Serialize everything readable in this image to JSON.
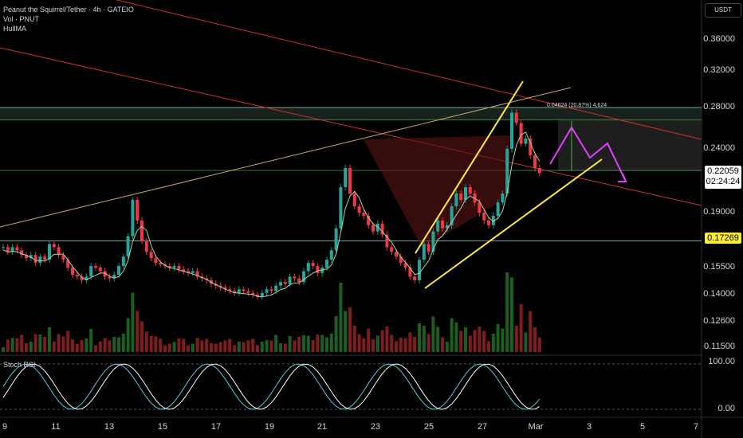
{
  "header": {
    "symbol_line": "Peanut the Squirrel/Tether · 4h · GATEIO",
    "volume_line": "Vol · PNUT",
    "indicator_line": "HullMA",
    "currency": "USDT"
  },
  "rsi": {
    "label": "Stoch RSI",
    "ticks": [
      "100.00",
      "0.00"
    ]
  },
  "annotation": "0.04624 (20.87%) 4,624",
  "price_badges": {
    "last": "0.22059",
    "countdown": "02:24:24",
    "level": "0.17269"
  },
  "colors": {
    "up": "#089981",
    "down": "#f23645",
    "bg": "#000000",
    "trend": "#ffeb3b",
    "projection": "#e040fb"
  },
  "chart_data": {
    "type": "candlestick",
    "y_ticks": [
      0.36,
      0.32,
      0.28,
      0.24,
      0.19,
      0.155,
      0.14,
      0.126,
      0.115
    ],
    "y_tick_labels": [
      "0.36000",
      "0.32000",
      "0.28000",
      "0.24000",
      "0.19000",
      "0.15500",
      "0.14000",
      "0.12600",
      "0.11500"
    ],
    "x_tick_labels": [
      "9",
      "11",
      "13",
      "15",
      "17",
      "19",
      "21",
      "23",
      "25",
      "27",
      "Mar",
      "3",
      "5",
      "7"
    ],
    "horizontal_levels": [
      0.28,
      0.268,
      0.172
    ],
    "closes": [
      0.168,
      0.165,
      0.168,
      0.166,
      0.163,
      0.161,
      0.163,
      0.158,
      0.162,
      0.16,
      0.17,
      0.168,
      0.163,
      0.16,
      0.155,
      0.151,
      0.15,
      0.148,
      0.15,
      0.156,
      0.155,
      0.153,
      0.15,
      0.149,
      0.151,
      0.156,
      0.162,
      0.175,
      0.2,
      0.185,
      0.172,
      0.165,
      0.161,
      0.158,
      0.157,
      0.156,
      0.155,
      0.156,
      0.154,
      0.153,
      0.152,
      0.153,
      0.15,
      0.149,
      0.148,
      0.146,
      0.145,
      0.144,
      0.143,
      0.142,
      0.141,
      0.143,
      0.142,
      0.141,
      0.14,
      0.139,
      0.141,
      0.143,
      0.142,
      0.145,
      0.147,
      0.146,
      0.15,
      0.149,
      0.147,
      0.153,
      0.158,
      0.156,
      0.152,
      0.155,
      0.16,
      0.166,
      0.18,
      0.21,
      0.225,
      0.205,
      0.195,
      0.19,
      0.188,
      0.182,
      0.178,
      0.183,
      0.176,
      0.168,
      0.165,
      0.162,
      0.158,
      0.155,
      0.15,
      0.148,
      0.16,
      0.17,
      0.165,
      0.178,
      0.185,
      0.18,
      0.182,
      0.195,
      0.205,
      0.2,
      0.21,
      0.205,
      0.198,
      0.19,
      0.185,
      0.182,
      0.188,
      0.198,
      0.205,
      0.24,
      0.275,
      0.265,
      0.245,
      0.25,
      0.235,
      0.225,
      0.221
    ]
  }
}
